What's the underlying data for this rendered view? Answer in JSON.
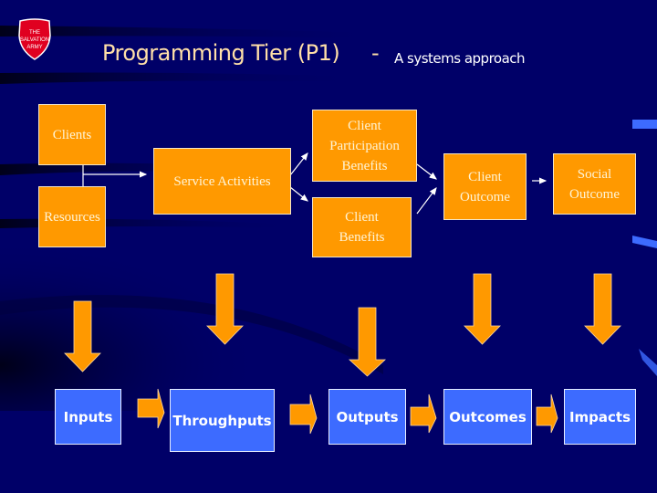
{
  "header": {
    "logo_text": "THE SALVATION ARMY",
    "title": "Programming Tier  (P1)",
    "separator": "-",
    "subtitle": "A systems approach"
  },
  "colors": {
    "background": "#000068",
    "orange": "#ff9900",
    "blue_box": "#3d6bff",
    "title_text": "#ffe0a8"
  },
  "top_flow": {
    "clients": "Clients",
    "resources": "Resources",
    "service_activities": "Service Activities",
    "client_participation_benefits": [
      "Client",
      "Participation",
      "Benefits"
    ],
    "client_benefits": [
      "Client",
      "Benefits"
    ],
    "client_outcome": [
      "Client",
      "Outcome"
    ],
    "social_outcome": [
      "Social",
      "Outcome"
    ]
  },
  "bottom_flow": {
    "stages": [
      "Inputs",
      "Throughputs",
      "Outputs",
      "Outcomes",
      "Impacts"
    ]
  }
}
